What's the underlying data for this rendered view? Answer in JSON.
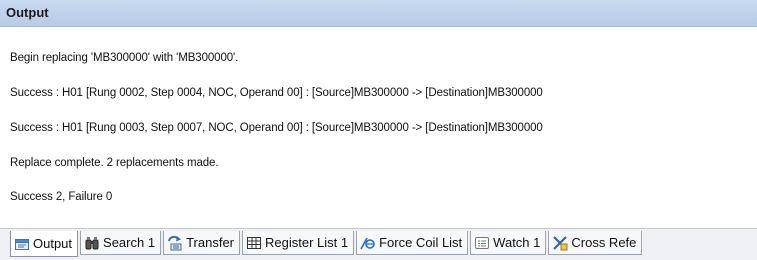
{
  "panel": {
    "title": "Output"
  },
  "output": {
    "lines": [
      "Begin replacing 'MB300000' with 'MB300000'.",
      "Success : H01 [Rung 0002, Step 0004, NOC, Operand 00] : [Source]MB300000 -> [Destination]MB300000",
      "Success : H01 [Rung 0003, Step 0007, NOC, Operand 00] : [Source]MB300000 -> [Destination]MB300000",
      "Replace complete. 2 replacements made.",
      "Success 2, Failure 0"
    ]
  },
  "tabs": [
    {
      "label": "Output",
      "icon": "output-icon",
      "active": true
    },
    {
      "label": "Search 1",
      "icon": "binoculars-icon",
      "active": false
    },
    {
      "label": "Transfer",
      "icon": "transfer-icon",
      "active": false
    },
    {
      "label": "Register List 1",
      "icon": "grid-icon",
      "active": false
    },
    {
      "label": "Force Coil List",
      "icon": "force-coil-icon",
      "active": false
    },
    {
      "label": "Watch 1",
      "icon": "watch-list-icon",
      "active": false
    },
    {
      "label": "Cross Refe",
      "icon": "cross-reference-icon",
      "active": false
    }
  ],
  "colors": {
    "title_bar": "#b7cbe6",
    "tab_strip": "#eef0f3"
  }
}
